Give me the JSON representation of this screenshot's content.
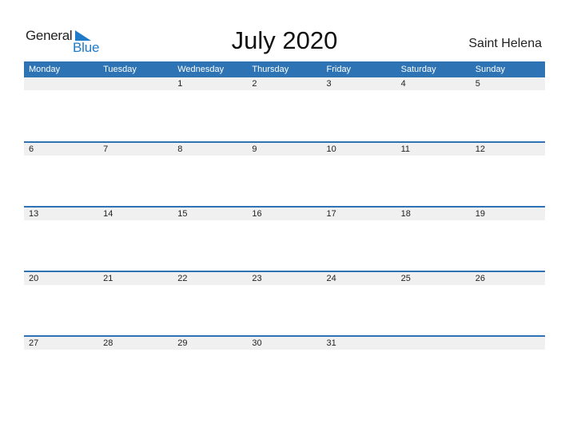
{
  "logo": {
    "general": "General",
    "blue": "Blue"
  },
  "title": "July 2020",
  "country": "Saint Helena",
  "days": [
    "Monday",
    "Tuesday",
    "Wednesday",
    "Thursday",
    "Friday",
    "Saturday",
    "Sunday"
  ],
  "weeks": [
    [
      "",
      "",
      "1",
      "2",
      "3",
      "4",
      "5"
    ],
    [
      "6",
      "7",
      "8",
      "9",
      "10",
      "11",
      "12"
    ],
    [
      "13",
      "14",
      "15",
      "16",
      "17",
      "18",
      "19"
    ],
    [
      "20",
      "21",
      "22",
      "23",
      "24",
      "25",
      "26"
    ],
    [
      "27",
      "28",
      "29",
      "30",
      "31",
      "",
      ""
    ]
  ],
  "colors": {
    "accent": "#2e74b5",
    "band": "#f0f0f0",
    "logo_blue": "#1f7bc8"
  }
}
